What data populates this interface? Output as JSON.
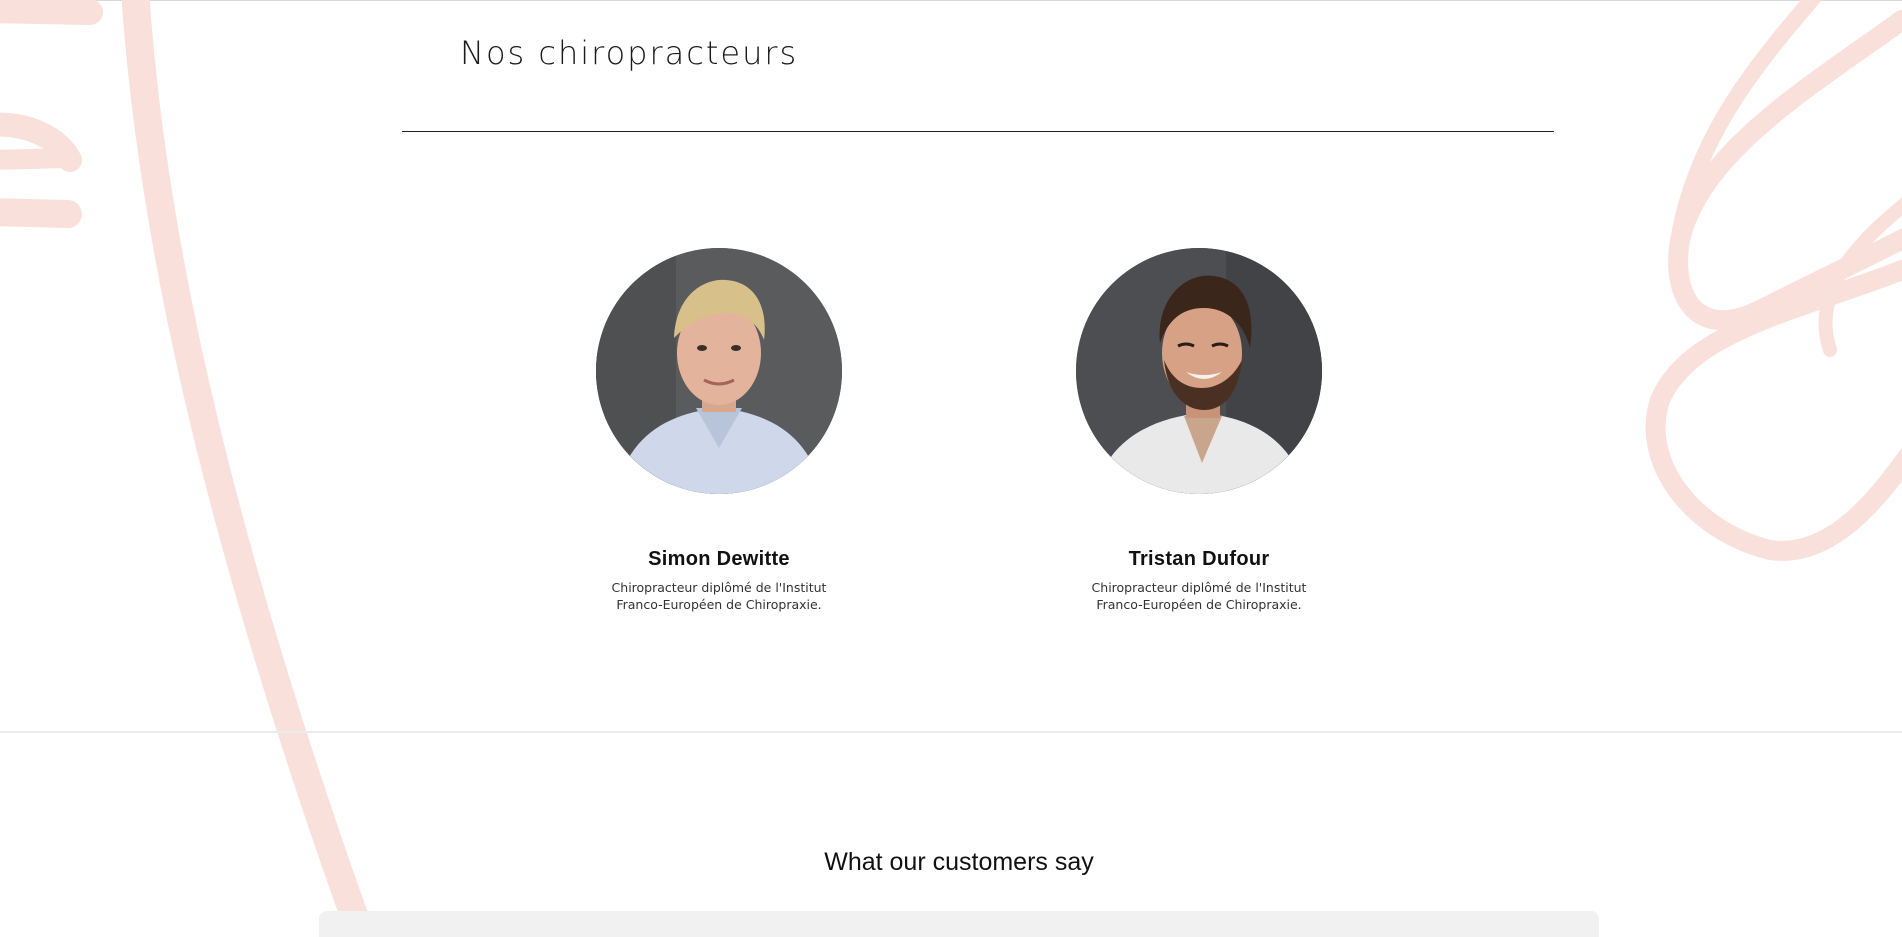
{
  "team_section": {
    "title": "Nos chiropracteurs",
    "members": [
      {
        "name": "Simon Dewitte",
        "bio_line1": "Chiropracteur diplômé de l'Institut",
        "bio_line2": "Franco-Européen de Chiropraxie."
      },
      {
        "name": "Tristan Dufour",
        "bio_line1": "Chiropracteur diplômé de l'Institut",
        "bio_line2": "Franco-Européen de Chiropraxie."
      }
    ]
  },
  "testimonials_section": {
    "title": "What our customers say"
  },
  "colors": {
    "decoration": "#f9e0da",
    "rule": "#222222",
    "panel": "#f1f1f1"
  }
}
